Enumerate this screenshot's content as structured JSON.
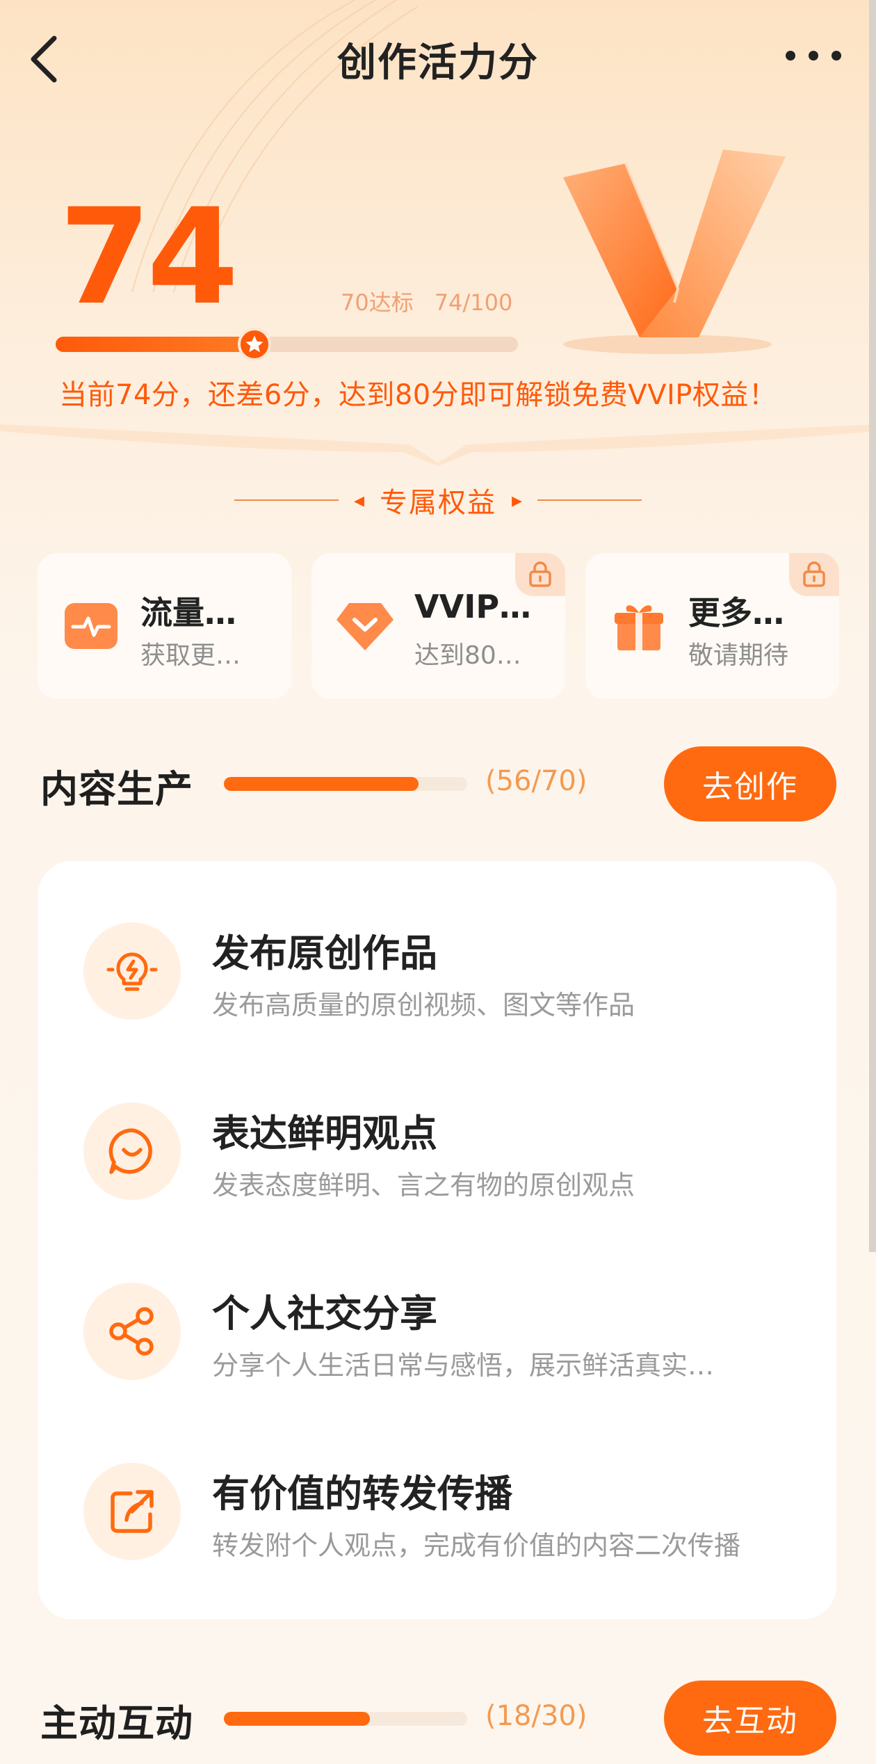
{
  "header": {
    "title": "创作活力分",
    "back_icon": "chevron-left-icon",
    "more_icon": "more-dots-icon"
  },
  "score": {
    "value": "74",
    "target_text": "70达标",
    "progress_text": "74/100",
    "progress_fraction": 0.74,
    "tip": "当前74分，还差6分，达到80分即可解锁免费VVIP权益！"
  },
  "benefits": {
    "title": "专属权益",
    "items": [
      {
        "name": "流量…",
        "sub": "获取更…",
        "icon": "traffic-pulse-icon",
        "locked": false
      },
      {
        "name": "VVIP…",
        "sub": "达到80…",
        "icon": "diamond-icon",
        "locked": true
      },
      {
        "name": "更多…",
        "sub": "敬请期待",
        "icon": "gift-icon",
        "locked": true
      }
    ]
  },
  "content_section": {
    "label": "内容生产",
    "count": "(56/70)",
    "progress_fraction": 0.8,
    "button": "去创作",
    "tasks": [
      {
        "name": "发布原创作品",
        "desc": "发布高质量的原创视频、图文等作品",
        "icon": "lightbulb-icon"
      },
      {
        "name": "表达鲜明观点",
        "desc": "发表态度鲜明、言之有物的原创观点",
        "icon": "chat-smile-icon"
      },
      {
        "name": "个人社交分享",
        "desc": "分享个人生活日常与感悟，展示鲜活真实…",
        "icon": "share-icon"
      },
      {
        "name": "有价值的转发传播",
        "desc": "转发附个人观点，完成有价值的内容二次传播",
        "icon": "forward-icon"
      }
    ]
  },
  "interaction_section": {
    "label": "主动互动",
    "count": "(18/30)",
    "progress_fraction": 0.6,
    "button": "去互动"
  },
  "colors": {
    "accent": "#ff5a0a",
    "button": "#ff6a10",
    "count": "#f39a50",
    "muted": "#9a9a9a"
  }
}
